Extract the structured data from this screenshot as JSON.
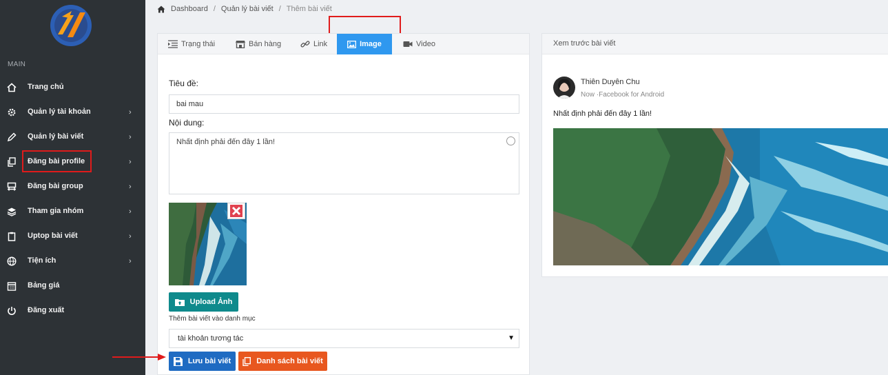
{
  "sidebar": {
    "section_title": "MAIN",
    "items": [
      {
        "label": "Trang chủ",
        "icon": "home-icon",
        "has_chevron": false
      },
      {
        "label": "Quản lý tài khoản",
        "icon": "gear-icon",
        "has_chevron": true
      },
      {
        "label": "Quản lý bài viết",
        "icon": "pencil-icon",
        "has_chevron": true
      },
      {
        "label": "Đăng bài profile",
        "icon": "copy-icon",
        "has_chevron": true
      },
      {
        "label": "Đăng bài group",
        "icon": "group-post-icon",
        "has_chevron": true
      },
      {
        "label": "Tham gia nhóm",
        "icon": "layers-icon",
        "has_chevron": true
      },
      {
        "label": "Uptop bài viết",
        "icon": "clipboard-icon",
        "has_chevron": true
      },
      {
        "label": "Tiện ích",
        "icon": "globe-icon",
        "has_chevron": true
      },
      {
        "label": "Bảng giá",
        "icon": "calendar-icon",
        "has_chevron": false
      },
      {
        "label": "Đăng xuất",
        "icon": "power-icon",
        "has_chevron": false
      }
    ]
  },
  "breadcrumb": {
    "items": [
      "Dashboard",
      "Quản lý bài viết",
      "Thêm bài viết"
    ],
    "separator": "/"
  },
  "tabs": [
    {
      "label": "Trạng thái",
      "icon": "align-icon",
      "active": false
    },
    {
      "label": "Bán hàng",
      "icon": "store-icon",
      "active": false
    },
    {
      "label": "Link",
      "icon": "link-icon",
      "active": false
    },
    {
      "label": "Image",
      "icon": "image-icon",
      "active": true
    },
    {
      "label": "Video",
      "icon": "video-icon",
      "active": false
    }
  ],
  "form": {
    "title_label": "Tiêu đề:",
    "title_value": "bai mau",
    "content_label": "Nội dung:",
    "content_value": "Nhất định phải đến đây 1 lần!",
    "upload_button": "Upload Ảnh",
    "category_label": "Thêm bài viết vào danh mục",
    "category_value": "tài khoản tương tác",
    "save_button": "Lưu bài viết",
    "list_button": "Danh sách bài viết"
  },
  "preview": {
    "header": "Xem trước bài viết",
    "author": "Thiên Duyên Chu",
    "meta": "Now ·Facebook for Android",
    "text": "Nhất định phải đến đây 1 lần!"
  },
  "colors": {
    "sidebar_bg": "#2d3236",
    "active_tab": "#2f98ef",
    "upload_button": "#0f8a8c",
    "save_button": "#1f6bc2",
    "list_button": "#e8571f",
    "highlight": "#e01b1b"
  }
}
